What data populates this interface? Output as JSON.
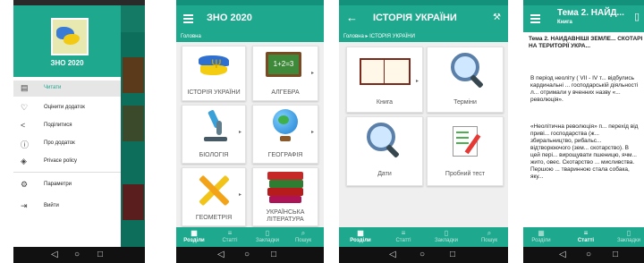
{
  "screen1": {
    "header_title": "ЗНО 2020",
    "menu": [
      {
        "icon": "book-icon",
        "label": "Читати"
      },
      {
        "icon": "heart-icon",
        "label": "Оцінити додаток"
      },
      {
        "icon": "share-icon",
        "label": "Поділитися"
      },
      {
        "icon": "info-icon",
        "label": "Про додаток"
      },
      {
        "icon": "shield-icon",
        "label": "Privace policy"
      },
      {
        "icon": "gear-icon",
        "label": "Параметри"
      },
      {
        "icon": "exit-icon",
        "label": "Вийти"
      }
    ]
  },
  "screen2": {
    "title": "ЗНО 2020",
    "breadcrumb": "Головна",
    "tiles": [
      {
        "icon": "ukraine-map-icon",
        "label": "ІСТОРІЯ УКРАЇНИ"
      },
      {
        "icon": "algebra-board-icon",
        "label": "АЛГЕБРА"
      },
      {
        "icon": "microscope-icon",
        "label": "БІОЛОГІЯ"
      },
      {
        "icon": "globe-icon",
        "label": "ГЕОГРАФІЯ"
      },
      {
        "icon": "geometry-tools-icon",
        "label": "ГЕОМЕТРІЯ"
      },
      {
        "icon": "books-icon",
        "label": "УКРАЇНСЬКА ЛІТЕРАТУРА"
      }
    ],
    "bottom_nav": [
      "Розділи",
      "Статті",
      "Закладки",
      "Пошук"
    ]
  },
  "screen3": {
    "title": "ІСТОРІЯ УКРАЇНИ",
    "breadcrumb": "Головна ▸ ІСТОРІЯ УКРАЇНИ",
    "tiles": [
      {
        "icon": "book-icon",
        "label": "Книга"
      },
      {
        "icon": "magnifier-icon",
        "label": "Терміни"
      },
      {
        "icon": "magnifier-dates-icon",
        "label": "Дати"
      },
      {
        "icon": "test-pencil-icon",
        "label": "Пробний тест"
      }
    ],
    "bottom_nav": [
      "Розділи",
      "Статті",
      "Закладки",
      "Пошук"
    ]
  },
  "screen4": {
    "title": "Тема 2. НАЙД...",
    "subtitle": "Книга",
    "heading": "Тема 2. НАЙДАВНІШІ ЗЕМЛЕ... СКОТАРІ НА ТЕРИТОРІЇ УКРА...",
    "paragraphs": [
      "В період неоліту ( VII - IV т... відбулись кардинальні ... господарській діяльності л... отримали у вченних назву «... революція».",
      "«Неолітична революція» п... перехід від приві... господарства (ж... збиральництво, рибальс... відтворюючого (зем... скотарство). В цей пері... вирощувати пшеницю, ячм... жито, овес. Скотарство ... мисливства. Першою ... тваринною стала собака, яку..."
    ],
    "bottom_nav": [
      "Розділи",
      "Статті",
      "Закладки"
    ]
  }
}
